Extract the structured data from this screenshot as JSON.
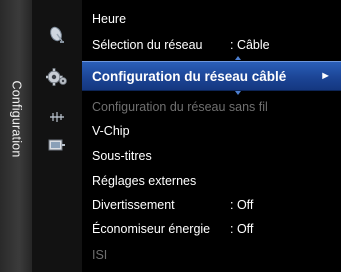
{
  "category": {
    "label": "Configuration"
  },
  "icons": [
    "satellite-dish-icon",
    "gear-settings-icon",
    "antenna-icon",
    "input-source-icon"
  ],
  "menu": {
    "items": [
      {
        "label": "Heure",
        "value": "",
        "state": "normal"
      },
      {
        "label": "Sélection du réseau",
        "value": ": Câble",
        "state": "normal"
      },
      {
        "label": "Configuration du réseau câblé",
        "value": "",
        "state": "selected",
        "arrow": "►"
      },
      {
        "label": "Configuration du réseau sans fil",
        "value": "",
        "state": "disabled"
      },
      {
        "label": "V-Chip",
        "value": "",
        "state": "normal"
      },
      {
        "label": "Sous-titres",
        "value": "",
        "state": "normal"
      },
      {
        "label": "Réglages externes",
        "value": "",
        "state": "normal"
      },
      {
        "label": "Divertissement",
        "value": ": Off",
        "state": "normal"
      },
      {
        "label": "Économiseur énergie",
        "value": ": Off",
        "state": "normal"
      },
      {
        "label": "ISI",
        "value": "",
        "state": "disabled"
      }
    ]
  },
  "colors": {
    "highlight": "#1c4596",
    "text": "#ffffff",
    "disabled_text": "#6f6f6f"
  }
}
